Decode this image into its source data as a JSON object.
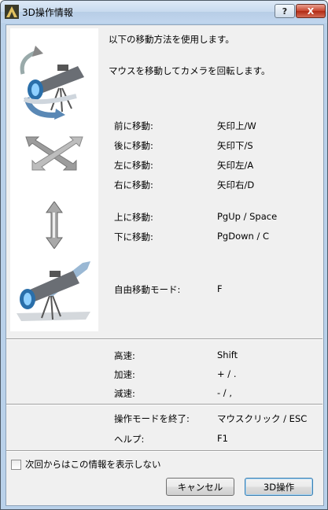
{
  "window": {
    "title": "3D操作情報",
    "help_label": "?",
    "close_label": "X"
  },
  "intro": {
    "line1": "以下の移動方法を使用します。",
    "line2": "マウスを移動してカメラを回転します。"
  },
  "moves": [
    {
      "label": "前に移動:",
      "key": "矢印上/W"
    },
    {
      "label": "後に移動:",
      "key": "矢印下/S"
    },
    {
      "label": "左に移動:",
      "key": "矢印左/A"
    },
    {
      "label": "右に移動:",
      "key": "矢印右/D"
    }
  ],
  "vertical": [
    {
      "label": "上に移動:",
      "key": "PgUp / Space"
    },
    {
      "label": "下に移動:",
      "key": "PgDown / C"
    }
  ],
  "free_mode": {
    "label": "自由移動モード:",
    "key": "F"
  },
  "speed": [
    {
      "label": "高速:",
      "key": "Shift"
    },
    {
      "label": "加速:",
      "key": "+ / ."
    },
    {
      "label": "減速:",
      "key": "- / ,"
    }
  ],
  "exit": {
    "label": "操作モードを終了:",
    "key": "マウスクリック / ESC"
  },
  "help": {
    "label": "ヘルプ:",
    "key": "F1"
  },
  "checkbox": {
    "label": "次回からはこの情報を表示しない",
    "checked": false
  },
  "buttons": {
    "cancel": "キャンセル",
    "ok": "3D操作"
  }
}
